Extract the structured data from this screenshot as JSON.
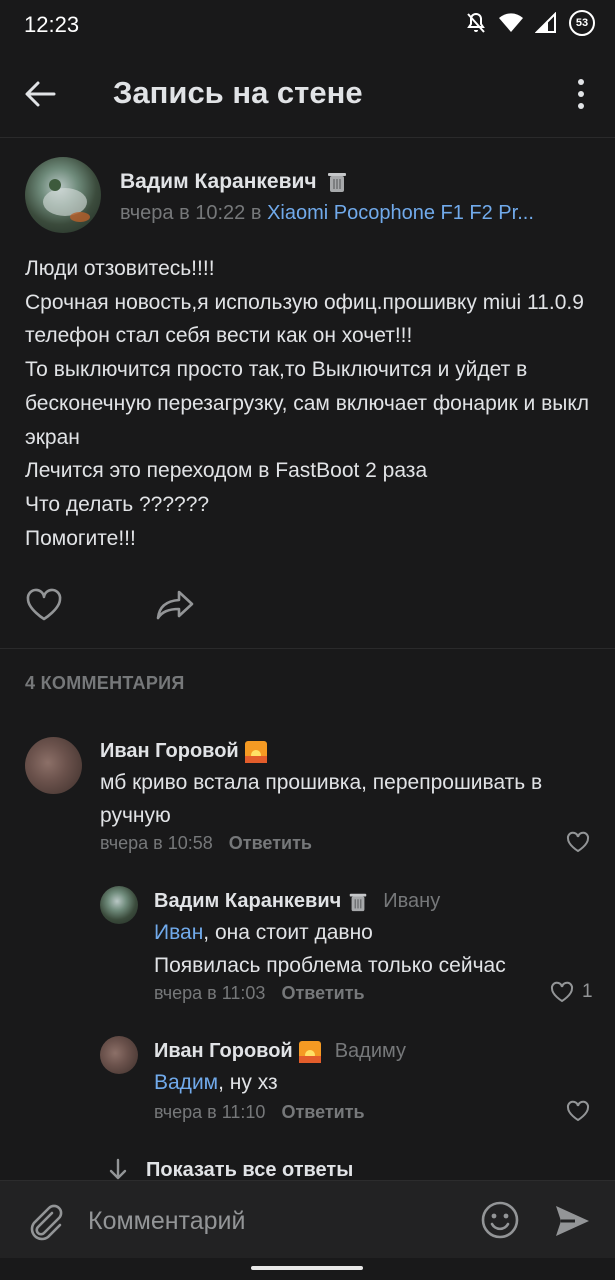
{
  "status": {
    "time": "12:23",
    "battery": "53"
  },
  "header": {
    "title": "Запись на стене"
  },
  "post": {
    "author": "Вадим Каранкевич",
    "time": "вчера в 10:22",
    "in_word": "в",
    "group": "Xiaomi Pocophone F1 F2 Pr...",
    "lines": [
      "Люди отзовитесь!!!!",
      "Срочная новость,я использую офиц.прошивку miui 11.0.9 телефон стал себя вести как он хочет!!!",
      "То выключится просто так,то  Выключится и уйдет в бесконечную перезагрузку, сам включает фонарик и выкл экран",
      "Лечится это переходом в FastBoot 2 раза",
      "Что делать ??????",
      "Помогите!!!"
    ]
  },
  "comments_header": "4 КОММЕНТАРИЯ",
  "comments": [
    {
      "author": "Иван Горовой",
      "text": "мб криво встала прошивка, перепрошивать в ручную",
      "time": "вчера в 10:58",
      "reply_label": "Ответить"
    },
    {
      "author": "Вадим Каранкевич",
      "reply_to": "Ивану",
      "mention": "Иван",
      "text_after_mention": ", она стоит давно",
      "text_line2": "Появилась проблема только сейчас",
      "time": "вчера в 11:03",
      "reply_label": "Ответить",
      "likes": "1"
    },
    {
      "author": "Иван Горовой",
      "reply_to": "Вадиму",
      "mention": "Вадим",
      "text_after_mention": ", ну хз",
      "time": "вчера в 11:10",
      "reply_label": "Ответить"
    }
  ],
  "show_all_replies": "Показать все ответы",
  "composer": {
    "placeholder": "Комментарий"
  },
  "colors": {
    "background": "#19191a",
    "link": "#71aaeb",
    "secondary_text": "#76787a",
    "text": "#e1e3e6"
  },
  "icons": [
    "back-arrow-icon",
    "more-vertical-icon",
    "trash-icon",
    "sunset-icon",
    "heart-icon",
    "share-icon",
    "attach-icon",
    "emoji-icon",
    "send-icon",
    "arrow-down-icon"
  ]
}
